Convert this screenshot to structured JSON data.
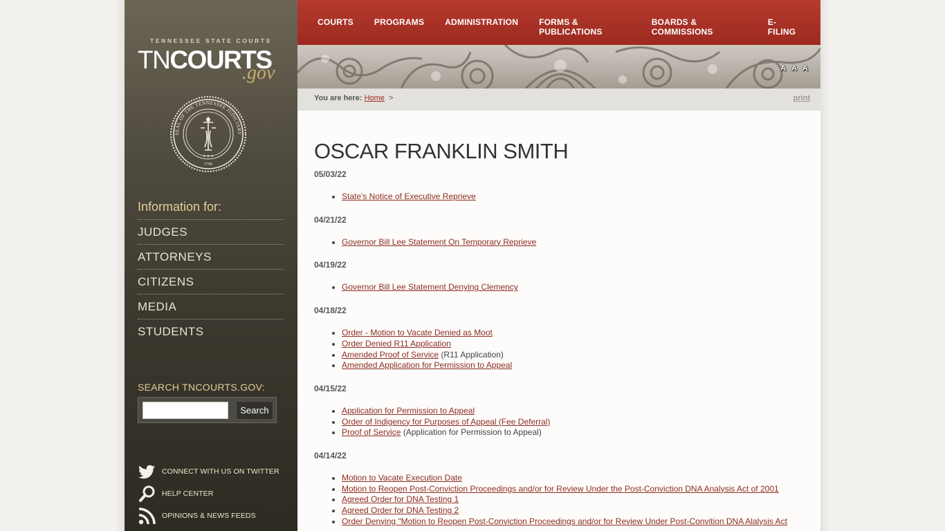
{
  "logo": {
    "small_text": "TENNESSEE STATE COURTS",
    "main_light": "TN",
    "main_bold": "COURTS",
    "suffix": ".gov",
    "seal_top_text": "SEAL OF THE TENNESSEE JUDICIARY",
    "seal_year": "1796"
  },
  "sidebar": {
    "info_heading": "Information for:",
    "nav": [
      "JUDGES",
      "ATTORNEYS",
      "CITIZENS",
      "MEDIA",
      "STUDENTS"
    ],
    "search_label": "SEARCH TNCOURTS.GOV:",
    "search_button": "Search",
    "search_value": "",
    "social": [
      {
        "icon": "twitter-icon",
        "label": "CONNECT WITH US ON TWITTER"
      },
      {
        "icon": "magnifier-icon",
        "label": "HELP CENTER"
      },
      {
        "icon": "rss-icon",
        "label": "OPINIONS & NEWS FEEDS"
      }
    ]
  },
  "topnav": [
    "COURTS",
    "PROGRAMS",
    "ADMINISTRATION",
    "FORMS & PUBLICATIONS",
    "BOARDS & COMMISSIONS",
    "E-FILING"
  ],
  "font_controls": [
    "A",
    "A",
    "A"
  ],
  "breadcrumb": {
    "label": "You are here:",
    "home": "Home",
    "separator": ">",
    "print": "print"
  },
  "page": {
    "title": "OSCAR FRANKLIN SMITH",
    "sections": [
      {
        "date": "05/03/22",
        "items": [
          {
            "link": "State's Notice of Executive Reprieve",
            "note": ""
          }
        ]
      },
      {
        "date": "04/21/22",
        "items": [
          {
            "link": "Governor Bill Lee Statement On Temporary Reprieve",
            "note": ""
          }
        ]
      },
      {
        "date": "04/19/22",
        "items": [
          {
            "link": "Governor Bill Lee Statement Denying Clemency",
            "note": ""
          }
        ]
      },
      {
        "date": "04/18/22",
        "items": [
          {
            "link": "Order - Motion to Vacate Denied as Moot",
            "note": ""
          },
          {
            "link": "Order Denied R11 Application",
            "note": ""
          },
          {
            "link": "Amended Proof of Service",
            "note": "(R11 Application)"
          },
          {
            "link": "Amended Application for Permission to Appeal",
            "note": ""
          }
        ]
      },
      {
        "date": "04/15/22",
        "items": [
          {
            "link": "Application for Permission to Appeal",
            "note": ""
          },
          {
            "link": "Order of Indigency for Purposes of Appeal (Fee Deferral)",
            "note": ""
          },
          {
            "link": "Proof of Service",
            "note": "(Application for Permission to Appeal)"
          }
        ]
      },
      {
        "date": "04/14/22",
        "items": [
          {
            "link": "Motion to Vacate Execution Date",
            "note": ""
          },
          {
            "link": "Motion to Reopen Post-Conviction Proceedings and/or for Review Under the Post-Conviction DNA Analysis Act of 2001",
            "note": ""
          },
          {
            "link": "Agreed Order for DNA Testing 1",
            "note": ""
          },
          {
            "link": "Agreed Order for DNA Testing 2",
            "note": ""
          },
          {
            "link": "Order Denying \"Motion to Reopen Post-Conviction Proceedings and/or for Review Under Post-Convition DNA Alalysis Act",
            "note": ""
          }
        ]
      }
    ]
  }
}
